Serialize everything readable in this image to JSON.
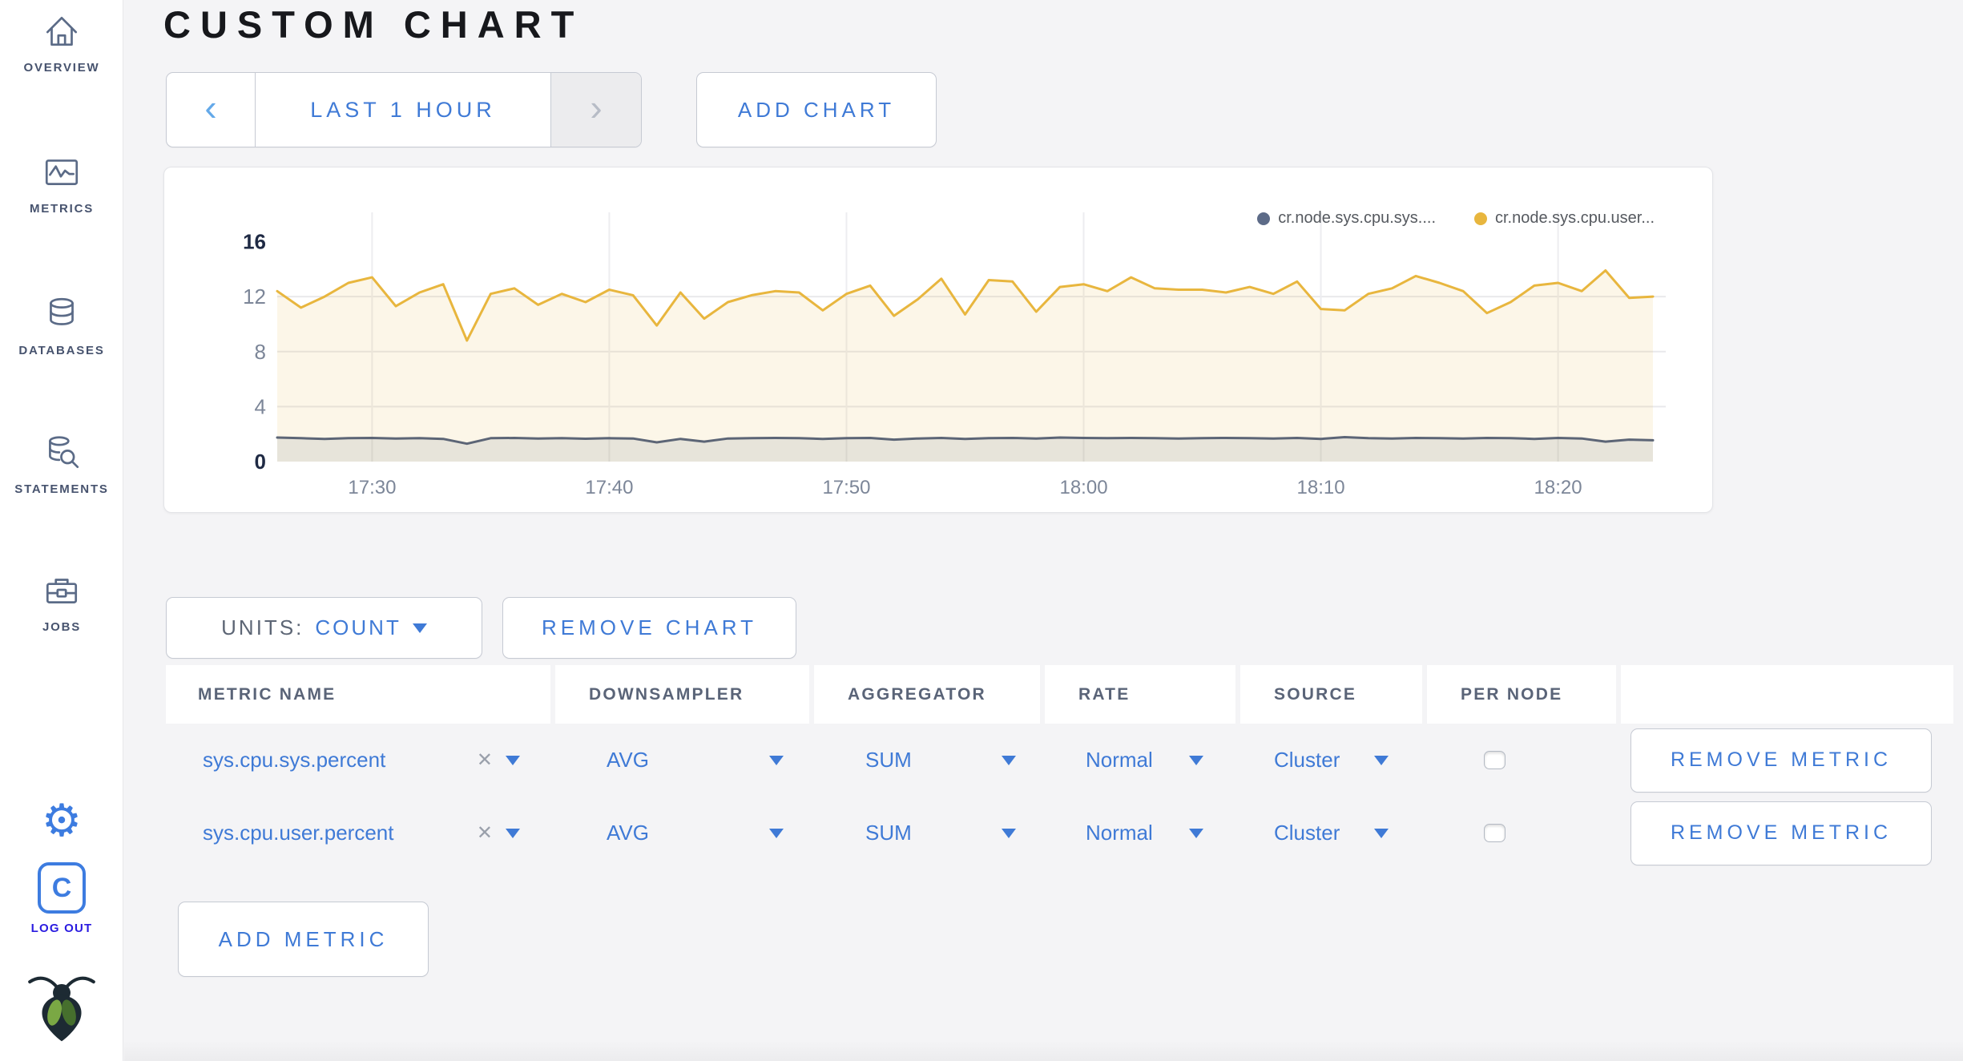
{
  "colors": {
    "accent_blue": "#3f7ad6",
    "icon_blue": "#3d7ce0",
    "logout_blue": "#2a1be0",
    "icon_slate": "#5b6b87",
    "slate_text": "#47536e",
    "header_text": "#5a6478",
    "title_color": "#17181c",
    "series_yellow": "#e8b63e",
    "series_gray": "#5c6576"
  },
  "sidebar": {
    "items": [
      {
        "label": "OVERVIEW"
      },
      {
        "label": "METRICS"
      },
      {
        "label": "DATABASES"
      },
      {
        "label": "STATEMENTS"
      },
      {
        "label": "JOBS"
      }
    ],
    "logout_label": "LOG OUT"
  },
  "header": {
    "title": "CUSTOM CHART"
  },
  "toolbar": {
    "prev_symbol": "‹",
    "range_label": "LAST 1 HOUR",
    "next_symbol": "›",
    "add_chart_label": "ADD CHART"
  },
  "chart_controls": {
    "units_label": "UNITS:",
    "units_value": "COUNT",
    "remove_chart_label": "REMOVE CHART",
    "add_metric_label": "ADD METRIC"
  },
  "chart_data": {
    "type": "line",
    "title": "",
    "grid": true,
    "legend_position": "top-right",
    "ylim": [
      0,
      16
    ],
    "yticks": [
      0,
      4,
      8,
      12,
      16
    ],
    "xtick_labels": [
      "17:30",
      "17:40",
      "17:50",
      "18:00",
      "18:10",
      "18:20"
    ],
    "xtick_indices": [
      4,
      14,
      24,
      34,
      44,
      54
    ],
    "x_times": [
      "17:26",
      "17:27",
      "17:28",
      "17:29",
      "17:30",
      "17:31",
      "17:32",
      "17:33",
      "17:34",
      "17:35",
      "17:36",
      "17:37",
      "17:38",
      "17:39",
      "17:40",
      "17:41",
      "17:42",
      "17:43",
      "17:44",
      "17:45",
      "17:46",
      "17:47",
      "17:48",
      "17:49",
      "17:50",
      "17:51",
      "17:52",
      "17:53",
      "17:54",
      "17:55",
      "17:56",
      "17:57",
      "17:58",
      "17:59",
      "18:00",
      "18:01",
      "18:02",
      "18:03",
      "18:04",
      "18:05",
      "18:06",
      "18:07",
      "18:08",
      "18:09",
      "18:10",
      "18:11",
      "18:12",
      "18:13",
      "18:14",
      "18:15",
      "18:16",
      "18:17",
      "18:18",
      "18:19",
      "18:20",
      "18:21",
      "18:22",
      "18:23",
      "18:24"
    ],
    "series": [
      {
        "name": "cr.node.sys.cpu.sys....",
        "color": "#5c6576",
        "fill": "rgba(96,106,124,0.13)",
        "values": [
          1.75,
          1.7,
          1.65,
          1.7,
          1.72,
          1.68,
          1.7,
          1.65,
          1.3,
          1.7,
          1.72,
          1.68,
          1.7,
          1.66,
          1.7,
          1.68,
          1.4,
          1.65,
          1.45,
          1.68,
          1.7,
          1.72,
          1.7,
          1.65,
          1.7,
          1.72,
          1.6,
          1.68,
          1.72,
          1.65,
          1.7,
          1.72,
          1.68,
          1.75,
          1.72,
          1.7,
          1.72,
          1.7,
          1.68,
          1.7,
          1.72,
          1.7,
          1.68,
          1.72,
          1.65,
          1.78,
          1.7,
          1.68,
          1.72,
          1.7,
          1.68,
          1.72,
          1.7,
          1.65,
          1.72,
          1.68,
          1.45,
          1.6,
          1.55
        ]
      },
      {
        "name": "cr.node.sys.cpu.user...",
        "color": "#e8b63e",
        "fill": "rgba(232,182,62,0.12)",
        "values": [
          12.4,
          11.2,
          12.0,
          13.0,
          13.4,
          11.3,
          12.3,
          12.9,
          8.8,
          12.2,
          12.6,
          11.4,
          12.2,
          11.6,
          12.5,
          12.1,
          9.9,
          12.3,
          10.4,
          11.6,
          12.1,
          12.4,
          12.3,
          11.0,
          12.2,
          12.8,
          10.6,
          11.8,
          13.3,
          10.7,
          13.2,
          13.1,
          10.9,
          12.7,
          12.9,
          12.4,
          13.4,
          12.6,
          12.5,
          12.5,
          12.3,
          12.7,
          12.2,
          13.1,
          11.1,
          11.0,
          12.2,
          12.6,
          13.5,
          13.0,
          12.4,
          10.8,
          11.6,
          12.8,
          13.0,
          12.4,
          13.9,
          11.9,
          12.0
        ]
      }
    ]
  },
  "metrics_table": {
    "columns": [
      "METRIC NAME",
      "DOWNSAMPLER",
      "AGGREGATOR",
      "RATE",
      "SOURCE",
      "PER NODE",
      ""
    ],
    "rows": [
      {
        "metric_name": "sys.cpu.sys.percent",
        "clear_symbol": "✕",
        "downsampler": "AVG",
        "aggregator": "SUM",
        "rate": "Normal",
        "source": "Cluster",
        "per_node_checked": false,
        "remove_metric_label": "REMOVE METRIC"
      },
      {
        "metric_name": "sys.cpu.user.percent",
        "clear_symbol": "✕",
        "downsampler": "AVG",
        "aggregator": "SUM",
        "rate": "Normal",
        "source": "Cluster",
        "per_node_checked": false,
        "remove_metric_label": "REMOVE METRIC"
      }
    ]
  }
}
